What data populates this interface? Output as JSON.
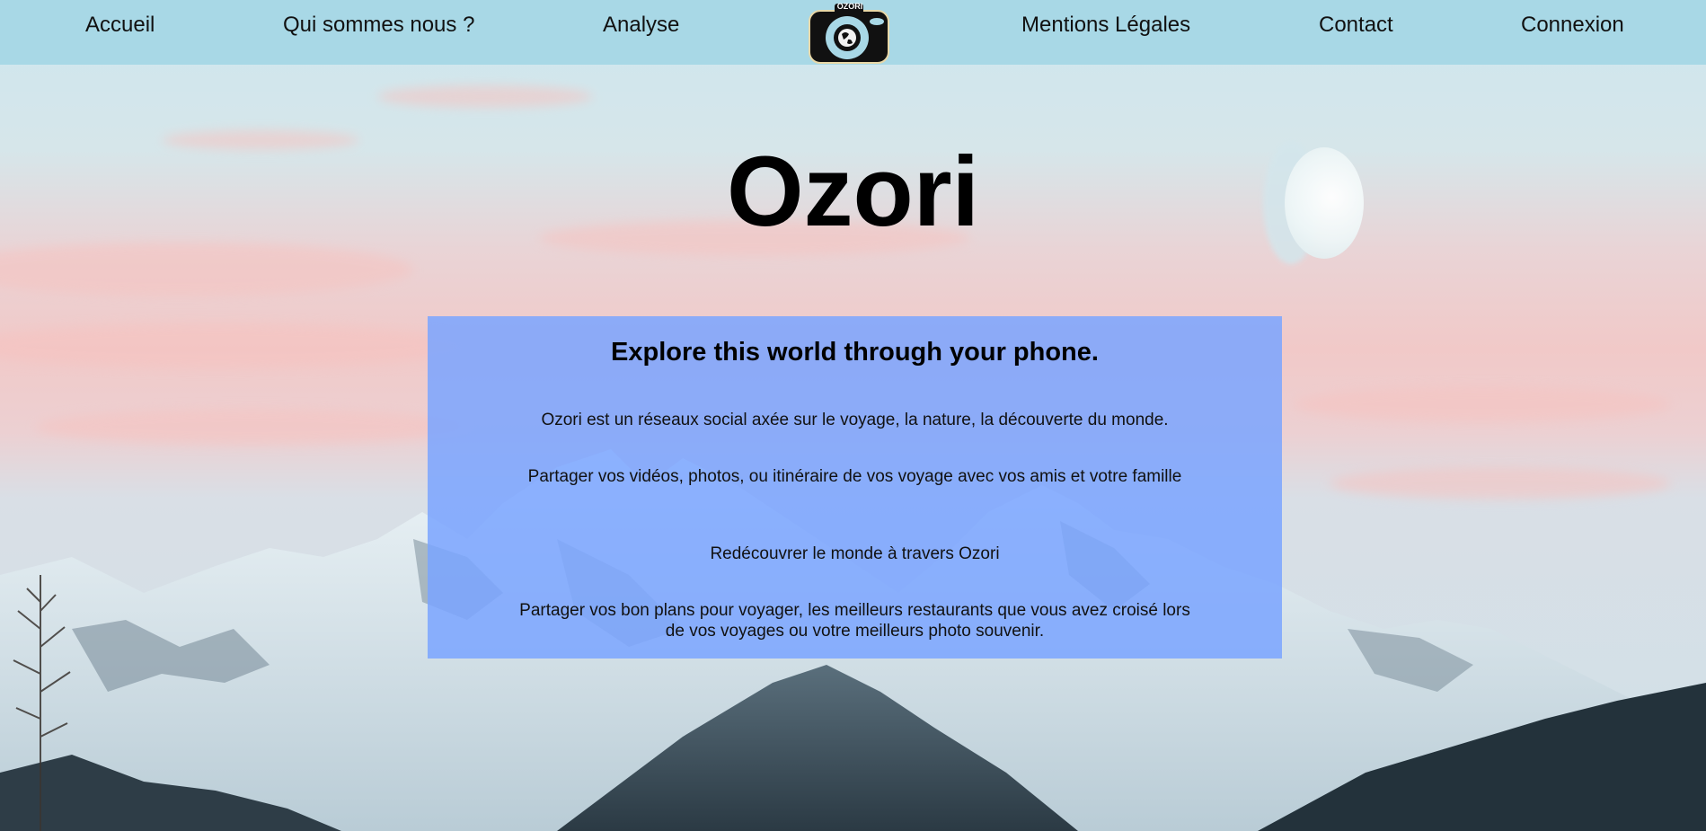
{
  "nav": {
    "items": [
      {
        "label": "Accueil"
      },
      {
        "label": "Qui sommes nous ?"
      },
      {
        "label": "Analyse"
      },
      {
        "label": "Mentions Légales"
      },
      {
        "label": "Contact"
      },
      {
        "label": "Connexion"
      }
    ],
    "logo_text": "OZORI",
    "background": "#a8d8e6"
  },
  "hero": {
    "title": "Ozori"
  },
  "info": {
    "heading": "Explore this world through your phone.",
    "paragraphs": [
      "Ozori est un réseaux social axée sur le voyage, la nature, la découverte du monde.",
      "Partager vos vidéos, photos, ou itinéraire de vos voyage avec vos amis et votre famille",
      "Redécouvrer le monde à travers Ozori",
      "Partager vos bon plans pour voyager, les meilleurs restaurants que vous avez croisé lors de vos voyages ou votre meilleurs photo souvenir."
    ],
    "background": "#7aa4ff"
  },
  "background_image": {
    "icon": "mountain-landscape-image"
  }
}
